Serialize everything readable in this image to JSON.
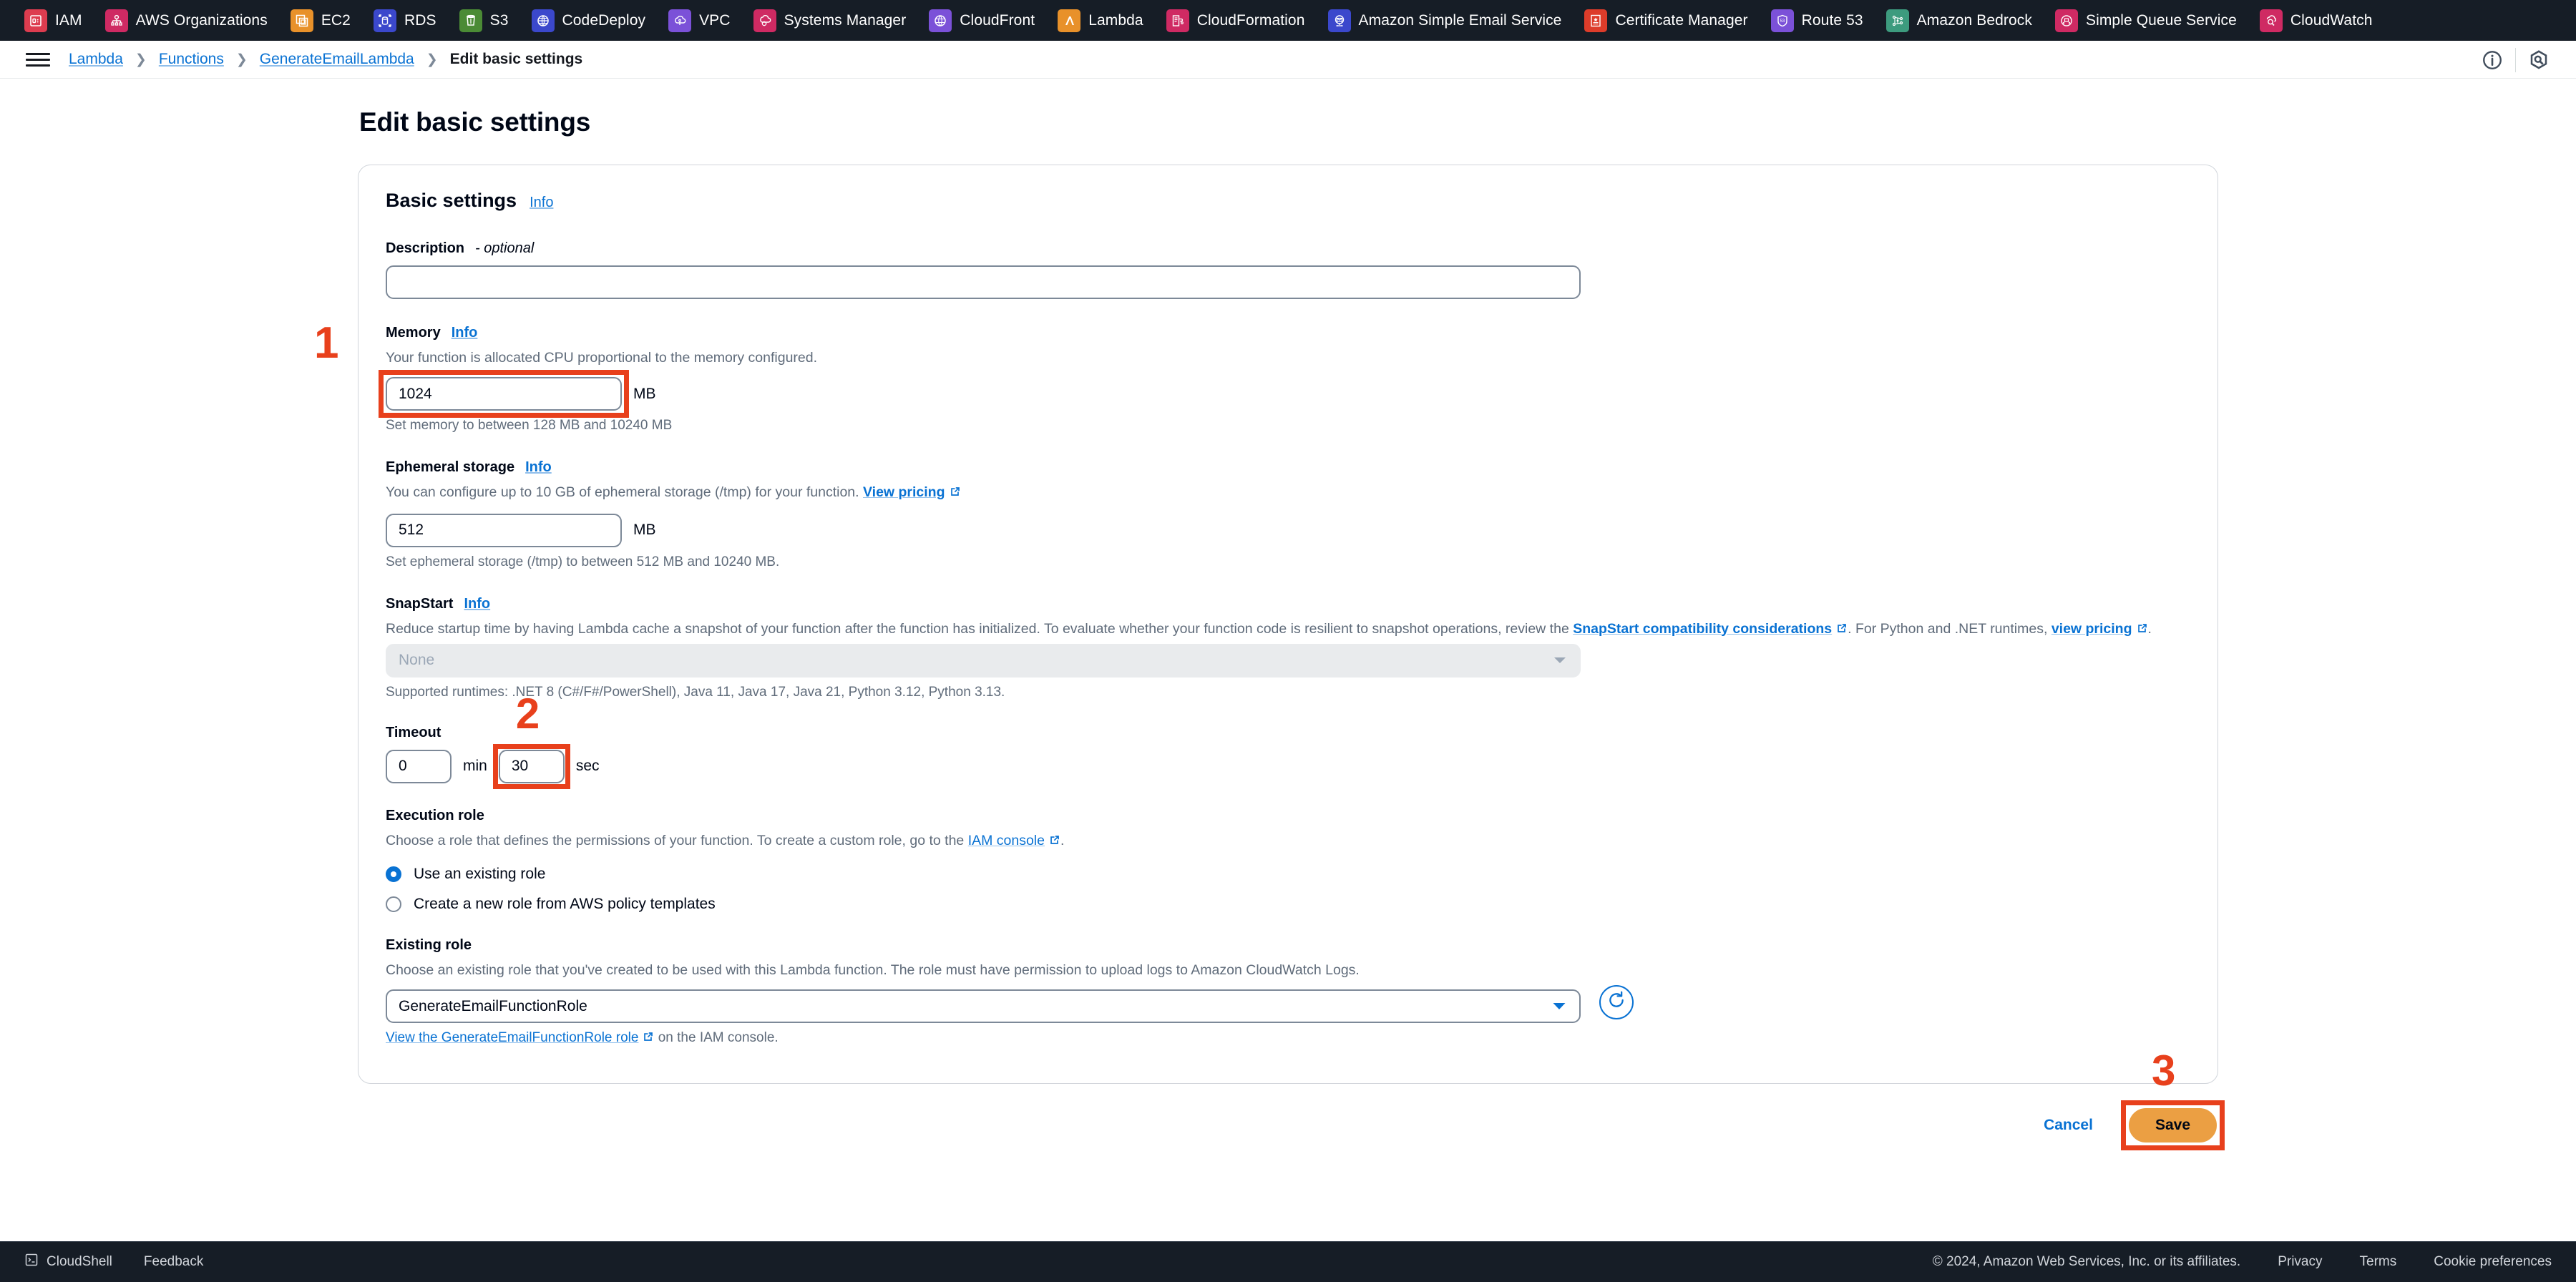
{
  "service_bar": {
    "items": [
      {
        "label": "IAM",
        "icon": "iam-icon",
        "color": "#dd3c4f"
      },
      {
        "label": "AWS Organizations",
        "icon": "aws-organizations-icon",
        "color": "#cf2a63"
      },
      {
        "label": "EC2",
        "icon": "ec2-icon",
        "color": "#e8912a"
      },
      {
        "label": "RDS",
        "icon": "rds-icon",
        "color": "#3b48cc"
      },
      {
        "label": "S3",
        "icon": "s3-icon",
        "color": "#4b8b35"
      },
      {
        "label": "CodeDeploy",
        "icon": "codedeploy-icon",
        "color": "#3b48cc"
      },
      {
        "label": "VPC",
        "icon": "vpc-icon",
        "color": "#7b51d8"
      },
      {
        "label": "Systems Manager",
        "icon": "systems-manager-icon",
        "color": "#cf2a63"
      },
      {
        "label": "CloudFront",
        "icon": "cloudfront-icon",
        "color": "#7b51d8"
      },
      {
        "label": "Lambda",
        "icon": "lambda-icon",
        "color": "#e8912a"
      },
      {
        "label": "CloudFormation",
        "icon": "cloudformation-icon",
        "color": "#cf2a63"
      },
      {
        "label": "Amazon Simple Email Service",
        "icon": "ses-icon",
        "color": "#3b48cc"
      },
      {
        "label": "Certificate Manager",
        "icon": "certificate-manager-icon",
        "color": "#dd3c2a"
      },
      {
        "label": "Route 53",
        "icon": "route53-icon",
        "color": "#7b51d8"
      },
      {
        "label": "Amazon Bedrock",
        "icon": "bedrock-icon",
        "color": "#3d9b7e"
      },
      {
        "label": "Simple Queue Service",
        "icon": "sqs-icon",
        "color": "#cf2a63"
      },
      {
        "label": "CloudWatch",
        "icon": "cloudwatch-icon",
        "color": "#cf2a63"
      }
    ]
  },
  "breadcrumb": {
    "items": [
      {
        "label": "Lambda",
        "current": false
      },
      {
        "label": "Functions",
        "current": false
      },
      {
        "label": "GenerateEmailLambda",
        "current": false
      },
      {
        "label": "Edit basic settings",
        "current": true
      }
    ],
    "separator": "❯",
    "info_icon": "info-circle-icon",
    "settings_icon": "console-settings-icon"
  },
  "page": {
    "title": "Edit basic settings"
  },
  "panel": {
    "title": "Basic settings",
    "info_label": "Info",
    "description": {
      "label": "Description",
      "optional_suffix": "- optional",
      "value": "",
      "placeholder": ""
    },
    "memory": {
      "label": "Memory",
      "info_label": "Info",
      "description": "Your function is allocated CPU proportional to the memory configured.",
      "value": "1024",
      "unit": "MB",
      "hint": "Set memory to between 128 MB and 10240 MB"
    },
    "ephemeral_storage": {
      "label": "Ephemeral storage",
      "info_label": "Info",
      "description_before": "You can configure up to 10 GB of ephemeral storage (/tmp) for your function.",
      "description_link": "View pricing",
      "value": "512",
      "unit": "MB",
      "hint": "Set ephemeral storage (/tmp) to between 512 MB and 10240 MB."
    },
    "snapstart": {
      "label": "SnapStart",
      "info_label": "Info",
      "description_part1": "Reduce startup time by having Lambda cache a snapshot of your function after the function has initialized. To evaluate whether your function code is resilient to snapshot operations, review the",
      "description_link1": "SnapStart compatibility considerations",
      "description_part2": ". For Python and .NET runtimes,",
      "description_link2": "view pricing",
      "description_part3": ".",
      "selected_value": "None",
      "disabled": true,
      "hint": "Supported runtimes: .NET 8 (C#/F#/PowerShell), Java 11, Java 17, Java 21, Python 3.12, Python 3.13."
    },
    "timeout": {
      "label": "Timeout",
      "min_value": "0",
      "min_unit": "min",
      "sec_value": "30",
      "sec_unit": "sec"
    },
    "execution_role": {
      "label": "Execution role",
      "description_before": "Choose a role that defines the permissions of your function. To create a custom role, go to the",
      "description_link": "IAM console",
      "description_after": ".",
      "options": [
        {
          "label": "Use an existing role",
          "selected": true
        },
        {
          "label": "Create a new role from AWS policy templates",
          "selected": false
        }
      ]
    },
    "existing_role": {
      "label": "Existing role",
      "description": "Choose an existing role that you've created to be used with this Lambda function. The role must have permission to upload logs to Amazon CloudWatch Logs.",
      "selected_value": "GenerateEmailFunctionRole",
      "refresh_icon": "refresh-icon",
      "view_role_link_before": "View the GenerateEmailFunctionRole role",
      "view_role_link_after": "on the IAM console."
    }
  },
  "actions": {
    "cancel_label": "Cancel",
    "save_label": "Save",
    "save_color": "#eb9f43"
  },
  "annotations": {
    "accent_color": "#e8401c",
    "markers": [
      {
        "number": "1",
        "target": "memory-input"
      },
      {
        "number": "2",
        "target": "timeout-sec-input"
      },
      {
        "number": "3",
        "target": "save-button"
      }
    ]
  },
  "footer": {
    "cloudshell_label": "CloudShell",
    "cloudshell_icon": "cloudshell-icon",
    "feedback_label": "Feedback",
    "copyright": "© 2024, Amazon Web Services, Inc. or its affiliates.",
    "privacy_label": "Privacy",
    "terms_label": "Terms",
    "cookie_label": "Cookie preferences"
  }
}
